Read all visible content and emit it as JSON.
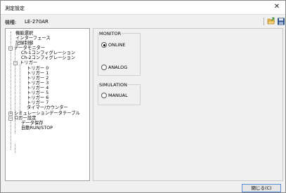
{
  "window": {
    "title": "測定設定",
    "close_glyph": "✕"
  },
  "model": {
    "label": "機種",
    "colon": ":",
    "value": "LE-270AR"
  },
  "toolbar": {
    "open_icon": "folder-open-icon",
    "save_icon": "save-disk-icon"
  },
  "tree": {
    "items": [
      {
        "label": "機能選択",
        "level": 1
      },
      {
        "label": "インターフェース",
        "level": 1
      },
      {
        "label": "記録制御",
        "level": 1
      },
      {
        "label": "データモニター",
        "level": 0,
        "toggle": "−"
      },
      {
        "label": "Ch-1コンフィグレーション",
        "level": 2
      },
      {
        "label": "Ch-2コンフィグレーション",
        "level": 2
      },
      {
        "label": "トリガー",
        "level": 1,
        "toggle": "−"
      },
      {
        "label": "トリガー 0",
        "level": 3
      },
      {
        "label": "トリガー 1",
        "level": 3
      },
      {
        "label": "トリガー 2",
        "level": 3
      },
      {
        "label": "トリガー 3",
        "level": 3
      },
      {
        "label": "トリガー 4",
        "level": 3
      },
      {
        "label": "トリガー 5",
        "level": 3
      },
      {
        "label": "トリガー 6",
        "level": 3
      },
      {
        "label": "トリガー 7",
        "level": 3
      },
      {
        "label": "タイマー/カウンター",
        "level": 3
      },
      {
        "label": "シミュレーションデータテーブル",
        "level": 0,
        "toggle": "+"
      },
      {
        "label": "ロガー設定",
        "level": 0,
        "toggle": "−"
      },
      {
        "label": "データ保存",
        "level": 1
      },
      {
        "label": "自動RUN/STOP",
        "level": 1
      }
    ]
  },
  "monitor": {
    "title": "MONITOR",
    "options": [
      {
        "label": "ONLINE",
        "selected": true
      },
      {
        "label": "ANALOG",
        "selected": false
      }
    ]
  },
  "simulation": {
    "title": "SIMULATION",
    "options": [
      {
        "label": "MANUAL",
        "selected": false
      }
    ]
  },
  "footer": {
    "close_label": "閉じる(C)"
  },
  "colors": {
    "focus_border": "#5a8fd6",
    "window_bg": "#f0f0f0"
  }
}
